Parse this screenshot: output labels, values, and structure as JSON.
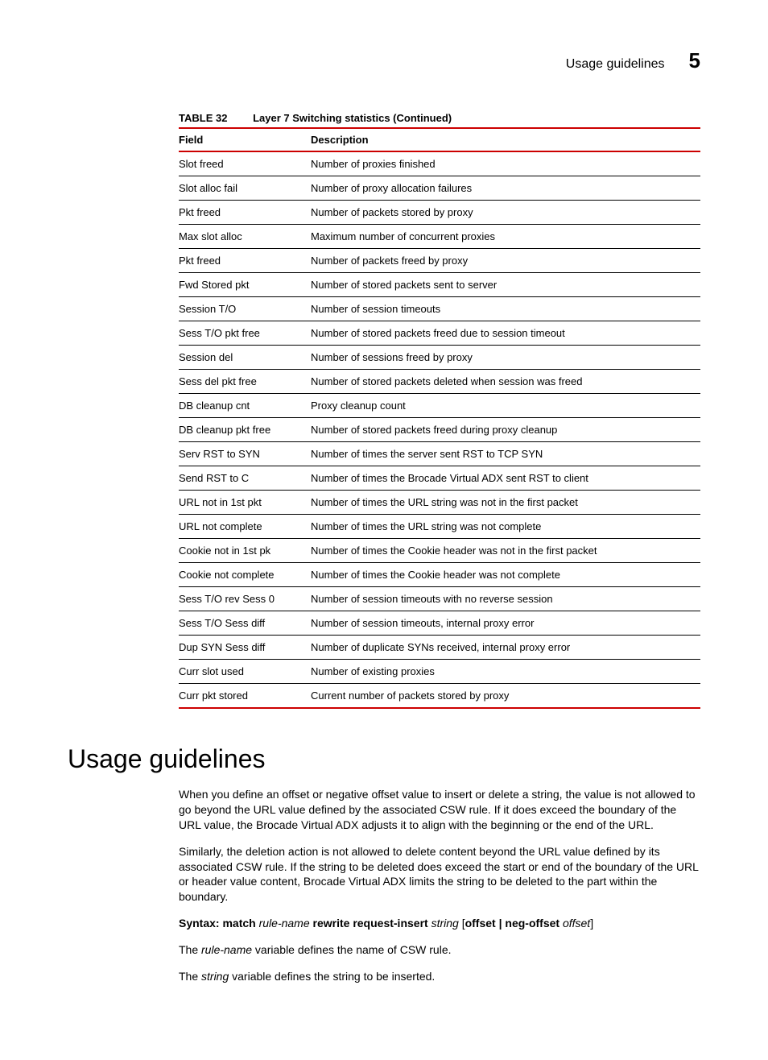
{
  "header": {
    "title": "Usage guidelines",
    "chapter": "5"
  },
  "table": {
    "label": "TABLE 32",
    "name": "Layer 7 Switching statistics (Continued)",
    "col_field": "Field",
    "col_desc": "Description",
    "rows": [
      {
        "field": "Slot freed",
        "desc": "Number of proxies finished"
      },
      {
        "field": "Slot alloc fail",
        "desc": "Number of proxy allocation failures"
      },
      {
        "field": "Pkt freed",
        "desc": "Number of packets stored by proxy"
      },
      {
        "field": "Max slot alloc",
        "desc": "Maximum number of concurrent proxies"
      },
      {
        "field": "Pkt freed",
        "desc": "Number of packets freed by proxy"
      },
      {
        "field": "Fwd Stored pkt",
        "desc": "Number of stored packets sent to server"
      },
      {
        "field": "Session T/O",
        "desc": "Number of session timeouts"
      },
      {
        "field": "Sess T/O pkt free",
        "desc": "Number of stored packets freed due to session timeout"
      },
      {
        "field": "Session del",
        "desc": "Number of sessions freed by proxy"
      },
      {
        "field": "Sess del pkt free",
        "desc": "Number of stored packets deleted when session was freed"
      },
      {
        "field": "DB cleanup cnt",
        "desc": "Proxy cleanup count"
      },
      {
        "field": "DB cleanup pkt free",
        "desc": "Number of stored packets freed during proxy cleanup"
      },
      {
        "field": "Serv RST to SYN",
        "desc": "Number of times the server sent RST to TCP SYN"
      },
      {
        "field": "Send RST to C",
        "desc": "Number of times the Brocade Virtual ADX sent RST to client"
      },
      {
        "field": "URL not in 1st pkt",
        "desc": "Number of times the URL string was not in the first packet"
      },
      {
        "field": "URL not complete",
        "desc": "Number of times the URL string was not complete"
      },
      {
        "field": "Cookie not in 1st pk",
        "desc": "Number of times the Cookie header was not in the first packet"
      },
      {
        "field": "Cookie not complete",
        "desc": "Number of times the Cookie header was not complete"
      },
      {
        "field": "Sess T/O rev Sess 0",
        "desc": "Number of session timeouts with no reverse session"
      },
      {
        "field": "Sess T/O Sess diff",
        "desc": "Number of session timeouts, internal proxy error"
      },
      {
        "field": "Dup SYN Sess diff",
        "desc": "Number of duplicate SYNs received, internal proxy error"
      },
      {
        "field": "Curr slot used",
        "desc": "Number of existing proxies"
      },
      {
        "field": "Curr pkt stored",
        "desc": "Current number of packets stored by proxy"
      }
    ]
  },
  "section": {
    "heading": "Usage guidelines",
    "p1": "When you define an offset or negative offset value to insert or delete a string, the value is not allowed to go beyond the URL value defined by the associated CSW rule. If it does exceed the boundary of the URL value, the Brocade Virtual ADX adjusts it to align with the beginning or the end of the URL.",
    "p2": "Similarly, the deletion action is not allowed to delete content beyond the URL value defined by its associated CSW rule. If the string to be deleted does exceed the start or end of the boundary of the URL or header value content, Brocade Virtual ADX limits the string to be deleted to the part within the boundary.",
    "syntax": {
      "kw_syntax": "Syntax:  match",
      "it_rule": " rule-name ",
      "kw_rewrite": "rewrite request-insert",
      "it_string": " string ",
      "br_open": "[",
      "kw_offset": "offset | neg-offset",
      "it_off": " offset",
      "br_close": "]"
    },
    "p4a": "The ",
    "p4b": "rule-name",
    "p4c": " variable defines the name of CSW rule.",
    "p5a": "The ",
    "p5b": "string",
    "p5c": " variable defines the string to be inserted."
  }
}
